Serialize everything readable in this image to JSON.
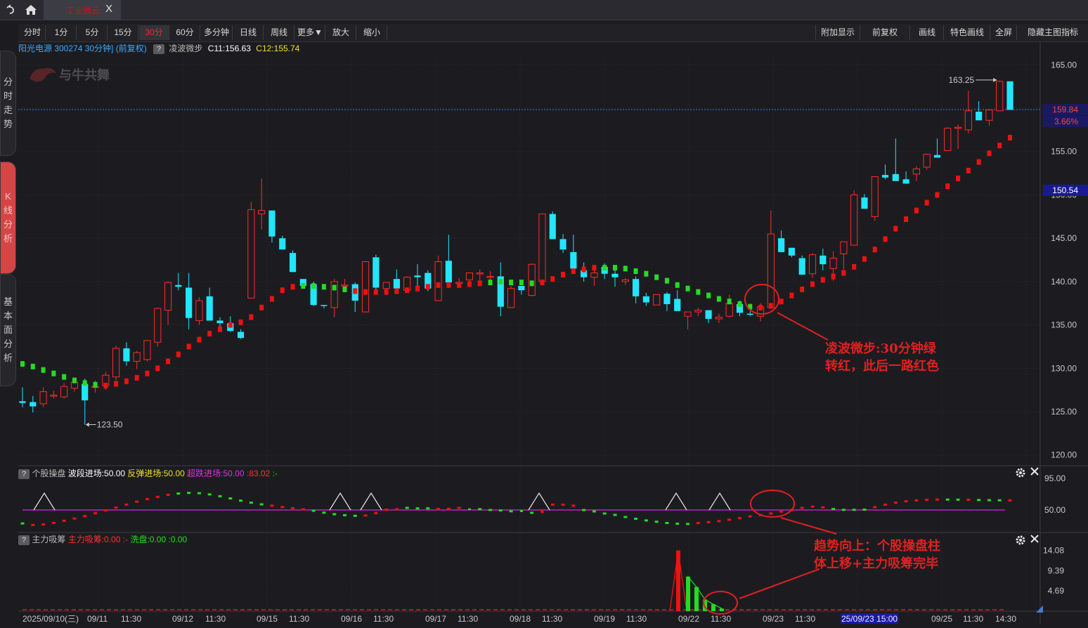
{
  "window": {
    "tab_title": "工业融云",
    "tab_close": "X"
  },
  "side_tabs": [
    {
      "label": "分\n时\n走\n势"
    },
    {
      "label": "K\n线\n分\n析"
    },
    {
      "label": "基\n本\n面\n分\n析"
    }
  ],
  "toolbar": {
    "left": [
      "分时",
      "1分",
      "5分",
      "15分",
      "30分",
      "60分",
      "多分钟",
      "日线",
      "周线",
      "更多▼",
      "放大",
      "缩小"
    ],
    "active": "30分",
    "right": [
      "附加显示",
      "前复权",
      "画线",
      "特色画线",
      "全屏",
      "隐藏主图指标"
    ]
  },
  "info": {
    "stock": "阳光电源 300274 30分钟] (前复权)",
    "help": "?",
    "indicator": "凌波微步",
    "c11": "C11:156.63",
    "c12": "C12:155.74"
  },
  "watermark": "与牛共舞",
  "colors": {
    "up": "#ff2a2a",
    "down": "#23e5ff",
    "green": "#22dd22",
    "red": "#ee1111",
    "magenta": "#dd22dd",
    "axis_text": "#c8c8c8"
  },
  "panel2": {
    "help": "?",
    "name": "个股操盘",
    "l1": "波段进场:50.00",
    "l2": "反弹进场:50.00",
    "l3": "超跌进场:50.00",
    "l4": ":83.02",
    "l5": ":-"
  },
  "panel3": {
    "help": "?",
    "name": "主力吸筹",
    "l1": "主力吸筹:0.00",
    "l2": ":-",
    "l3": "洗盘:0.00",
    "l4": ":0.00"
  },
  "annotations": {
    "a1_line1": "凌波微步:30分钟绿",
    "a1_line2": "转红，此后一路红色",
    "a2_line1": "趋势向上：个股操盘柱",
    "a2_line2": "体上移+主力吸筹完毕"
  },
  "chart_data": [
    {
      "type": "candlestick",
      "title": "阳光电源 300274 30分钟",
      "ylim": [
        119,
        166
      ],
      "yticks": [
        165,
        160,
        155,
        150,
        145,
        140,
        135,
        130,
        125,
        120
      ],
      "ytick_labels": [
        "165.00",
        "",
        "155.00",
        "150.00",
        "145.00",
        "140.00",
        "135.00",
        "130.00",
        "125.00",
        "120.00"
      ],
      "price_tags": [
        {
          "label": "159.84",
          "value": 159.84
        },
        {
          "label": "3.66%",
          "value": 158.4
        },
        {
          "label": "150.54",
          "value": 150.54
        }
      ],
      "markers": [
        {
          "label": "163.25",
          "value": 163.25
        },
        {
          "label": "123.50",
          "value": 123.5
        }
      ],
      "x_labels": [
        "2025/09/10(三)",
        "09/11",
        "11:30",
        "09/12",
        "11:30",
        "09/15",
        "11:30",
        "09/16",
        "11:30",
        "09/17",
        "11:30",
        "09/18",
        "11:30",
        "09/19",
        "11:30",
        "09/22",
        "11:30",
        "09/23",
        "11:30",
        "25/09/23 15:00",
        "09/25",
        "11:30",
        "14:30"
      ],
      "ohlc": [
        [
          126.2,
          127.8,
          125.5,
          126.0
        ],
        [
          126.1,
          126.8,
          124.9,
          125.6
        ],
        [
          125.9,
          127.8,
          125.5,
          127.3
        ],
        [
          126.9,
          127.4,
          126.5,
          126.9
        ],
        [
          126.7,
          128.3,
          126.5,
          127.9
        ],
        [
          127.7,
          128.9,
          127.3,
          128.4
        ],
        [
          128.2,
          128.8,
          123.5,
          126.3
        ],
        [
          127.8,
          128.6,
          127.2,
          127.9
        ],
        [
          128.0,
          129.6,
          127.5,
          129.2
        ],
        [
          129.0,
          132.6,
          128.6,
          132.3
        ],
        [
          132.3,
          133.0,
          130.3,
          130.8
        ],
        [
          130.8,
          132.0,
          129.9,
          131.8
        ],
        [
          131.0,
          133.2,
          130.8,
          133.2
        ],
        [
          133.0,
          137.0,
          132.5,
          136.9
        ],
        [
          136.7,
          140.0,
          135.0,
          139.9
        ],
        [
          139.6,
          141.0,
          139.0,
          139.4
        ],
        [
          139.3,
          141.0,
          134.5,
          135.8
        ],
        [
          135.5,
          138.2,
          135.0,
          137.8
        ],
        [
          138.3,
          139.3,
          136.0,
          135.5
        ],
        [
          135.5,
          135.9,
          134.7,
          135.2
        ],
        [
          135.2,
          136.0,
          134.2,
          134.3
        ],
        [
          134.2,
          134.5,
          133.4,
          133.5
        ],
        [
          138.1,
          149.2,
          138.3,
          148.3
        ],
        [
          147.8,
          151.9,
          146.0,
          148.2
        ],
        [
          148.2,
          148.2,
          144.5,
          145.2
        ],
        [
          145.0,
          145.3,
          143.7,
          143.7
        ],
        [
          143.3,
          143.6,
          141.1,
          141.1
        ],
        [
          140.3,
          140.2,
          139.5,
          139.5
        ],
        [
          139.7,
          140.0,
          137.2,
          137.3
        ],
        [
          137.3,
          137.3,
          136.9,
          137.2
        ],
        [
          137.0,
          140.3,
          135.9,
          140.0
        ],
        [
          139.6,
          140.3,
          139.5,
          139.6
        ],
        [
          139.7,
          139.9,
          136.5,
          137.8
        ],
        [
          136.5,
          142.0,
          136.5,
          142.3
        ],
        [
          142.8,
          143.1,
          139.0,
          139.3
        ],
        [
          139.2,
          139.9,
          139.0,
          139.9
        ],
        [
          140.3,
          141.4,
          139.4,
          139.2
        ],
        [
          139.0,
          140.6,
          139.0,
          140.5
        ],
        [
          140.7,
          142.0,
          139.5,
          140.5
        ],
        [
          141.0,
          141.3,
          138.9,
          139.2
        ],
        [
          137.8,
          143.0,
          138.1,
          142.3
        ],
        [
          142.4,
          145.4,
          139.7,
          139.9
        ],
        [
          139.9,
          140.4,
          139.5,
          139.9
        ],
        [
          140.2,
          141.0,
          140.0,
          141.0
        ],
        [
          140.9,
          141.4,
          140.1,
          141.0
        ],
        [
          140.5,
          141.2,
          139.7,
          140.6
        ],
        [
          140.6,
          142.2,
          136.0,
          137.1
        ],
        [
          137.0,
          139.5,
          137.0,
          139.2
        ],
        [
          139.5,
          139.4,
          138.5,
          139.0
        ],
        [
          138.4,
          142.1,
          138.3,
          142.0
        ],
        [
          140.0,
          147.8,
          141.4,
          147.8
        ],
        [
          147.8,
          148.1,
          144.9,
          144.9
        ],
        [
          144.9,
          145.5,
          143.3,
          143.7
        ],
        [
          143.4,
          145.4,
          142.7,
          141.5
        ],
        [
          141.3,
          142.2,
          140.0,
          140.5
        ],
        [
          140.5,
          141.7,
          139.5,
          141.0
        ],
        [
          141.7,
          142.1,
          140.3,
          140.9
        ],
        [
          140.9,
          141.5,
          139.4,
          140.5
        ],
        [
          140.0,
          140.4,
          139.6,
          140.2
        ],
        [
          140.3,
          140.6,
          137.5,
          138.3
        ],
        [
          138.3,
          138.7,
          137.2,
          137.6
        ],
        [
          137.3,
          138.5,
          137.8,
          138.5
        ],
        [
          138.6,
          138.8,
          136.6,
          137.4
        ],
        [
          138.0,
          139.0,
          136.7,
          136.6
        ],
        [
          136.0,
          136.5,
          134.5,
          136.5
        ],
        [
          136.5,
          137.0,
          136.0,
          136.7
        ],
        [
          136.7,
          136.2,
          135.2,
          135.7
        ],
        [
          135.7,
          136.3,
          135.2,
          135.9
        ],
        [
          136.0,
          138.5,
          136.0,
          137.5
        ],
        [
          137.4,
          137.8,
          136.0,
          136.4
        ],
        [
          136.3,
          136.6,
          136.0,
          136.2
        ],
        [
          136.0,
          137.5,
          135.4,
          137.1
        ],
        [
          137.0,
          148.2,
          137.2,
          145.5
        ],
        [
          145.0,
          145.9,
          143.6,
          143.4
        ],
        [
          143.9,
          143.9,
          142.8,
          143.0
        ],
        [
          142.7,
          143.0,
          140.8,
          140.8
        ],
        [
          140.9,
          143.3,
          140.4,
          143.1
        ],
        [
          143.0,
          143.8,
          141.3,
          142.0
        ],
        [
          141.5,
          143.5,
          140.1,
          142.7
        ],
        [
          143.2,
          144.2,
          141.4,
          144.6
        ],
        [
          144.2,
          150.5,
          144.5,
          150.0
        ],
        [
          149.7,
          150.1,
          148.4,
          148.4
        ],
        [
          147.5,
          152.1,
          147.0,
          152.1
        ],
        [
          152.3,
          153.5,
          151.8,
          152.0
        ],
        [
          152.4,
          156.5,
          151.6,
          151.6
        ],
        [
          151.8,
          152.7,
          151.3,
          151.3
        ],
        [
          152.4,
          153.3,
          151.6,
          153.0
        ],
        [
          153.2,
          154.7,
          152.9,
          154.7
        ],
        [
          154.6,
          156.5,
          154.4,
          154.3
        ],
        [
          155.1,
          157.8,
          155.7,
          157.7
        ],
        [
          157.7,
          158.1,
          155.3,
          157.8
        ],
        [
          157.5,
          162.0,
          157.1,
          159.7
        ],
        [
          159.6,
          160.8,
          158.8,
          158.6
        ],
        [
          158.6,
          159.8,
          158.0,
          159.8
        ],
        [
          159.7,
          163.2,
          159.8,
          163.1
        ],
        [
          163.1,
          162.9,
          159.8,
          159.8
        ]
      ],
      "ling_bo_wei_bu": [
        [
          130.5,
          "g"
        ],
        [
          130.2,
          "g"
        ],
        [
          129.8,
          "g"
        ],
        [
          129.4,
          "g"
        ],
        [
          129.0,
          "g"
        ],
        [
          128.6,
          "g"
        ],
        [
          128.3,
          "g"
        ],
        [
          128.1,
          "g"
        ],
        [
          128.0,
          "r"
        ],
        [
          128.2,
          "r"
        ],
        [
          128.5,
          "r"
        ],
        [
          128.9,
          "r"
        ],
        [
          129.4,
          "r"
        ],
        [
          130.0,
          "r"
        ],
        [
          130.8,
          "r"
        ],
        [
          131.6,
          "r"
        ],
        [
          132.5,
          "r"
        ],
        [
          133.3,
          "r"
        ],
        [
          134.0,
          "r"
        ],
        [
          134.5,
          "r"
        ],
        [
          135.0,
          "r"
        ],
        [
          135.3,
          "r"
        ],
        [
          135.9,
          "r"
        ],
        [
          137.0,
          "r"
        ],
        [
          138.0,
          "r"
        ],
        [
          139.0,
          "r"
        ],
        [
          139.4,
          "r"
        ],
        [
          139.5,
          "g"
        ],
        [
          139.5,
          "g"
        ],
        [
          139.4,
          "g"
        ],
        [
          139.3,
          "g"
        ],
        [
          139.1,
          "g"
        ],
        [
          138.9,
          "r"
        ],
        [
          138.8,
          "r"
        ],
        [
          138.8,
          "r"
        ],
        [
          138.8,
          "r"
        ],
        [
          138.9,
          "r"
        ],
        [
          139.0,
          "r"
        ],
        [
          139.2,
          "r"
        ],
        [
          139.4,
          "r"
        ],
        [
          139.6,
          "r"
        ],
        [
          139.6,
          "r"
        ],
        [
          139.6,
          "r"
        ],
        [
          139.7,
          "r"
        ],
        [
          139.8,
          "r"
        ],
        [
          139.9,
          "g"
        ],
        [
          140.0,
          "g"
        ],
        [
          139.9,
          "g"
        ],
        [
          139.9,
          "g"
        ],
        [
          139.8,
          "g"
        ],
        [
          139.9,
          "r"
        ],
        [
          140.3,
          "r"
        ],
        [
          140.8,
          "r"
        ],
        [
          141.2,
          "r"
        ],
        [
          141.4,
          "r"
        ],
        [
          141.6,
          "r"
        ],
        [
          141.6,
          "g"
        ],
        [
          141.6,
          "g"
        ],
        [
          141.5,
          "g"
        ],
        [
          141.2,
          "g"
        ],
        [
          140.9,
          "g"
        ],
        [
          140.5,
          "g"
        ],
        [
          140.1,
          "g"
        ],
        [
          139.6,
          "g"
        ],
        [
          139.2,
          "g"
        ],
        [
          138.8,
          "g"
        ],
        [
          138.4,
          "g"
        ],
        [
          138.0,
          "g"
        ],
        [
          137.7,
          "g"
        ],
        [
          137.4,
          "g"
        ],
        [
          137.1,
          "g"
        ],
        [
          137.0,
          "r"
        ],
        [
          137.2,
          "r"
        ],
        [
          137.7,
          "r"
        ],
        [
          138.4,
          "r"
        ],
        [
          139.1,
          "r"
        ],
        [
          139.7,
          "r"
        ],
        [
          140.2,
          "r"
        ],
        [
          140.6,
          "r"
        ],
        [
          141.0,
          "r"
        ],
        [
          141.7,
          "r"
        ],
        [
          142.6,
          "r"
        ],
        [
          143.7,
          "r"
        ],
        [
          144.9,
          "r"
        ],
        [
          146.1,
          "r"
        ],
        [
          147.2,
          "r"
        ],
        [
          148.2,
          "r"
        ],
        [
          149.1,
          "r"
        ],
        [
          150.0,
          "r"
        ],
        [
          151.0,
          "r"
        ],
        [
          151.9,
          "r"
        ],
        [
          152.8,
          "r"
        ],
        [
          153.8,
          "r"
        ],
        [
          154.8,
          "r"
        ],
        [
          155.7,
          "r"
        ],
        [
          156.6,
          "r"
        ]
      ]
    },
    {
      "type": "bar",
      "title": "个股操盘",
      "ylim": [
        45,
        100
      ],
      "ytick_labels": [
        "95.00",
        "50.00"
      ],
      "baseline": 50,
      "values": [
        30.8,
        28.6,
        29.4,
        31.6,
        34.6,
        37.8,
        41.3,
        45.3,
        49.4,
        53.5,
        57.7,
        61.8,
        65.5,
        68.7,
        71.5,
        73.4,
        74.3,
        73.9,
        72.2,
        69.6,
        66.5,
        63.3,
        60.4,
        58.0,
        56.2,
        54.2,
        52.6,
        50.9,
        48.9,
        46.2,
        44.0,
        42.6,
        41.7,
        42.2,
        45.5,
        50.5,
        51.0,
        53.0,
        52.3,
        52.3,
        51.4,
        51.7,
        53.0,
        52.3,
        51.2,
        50.0,
        49.3,
        48.2,
        47.0,
        46.0,
        45.5,
        57.6,
        57.5,
        56.2,
        49.9,
        48.0,
        45.0,
        43.0,
        40.0,
        37.5,
        35.1,
        33.3,
        31.5,
        30.4,
        30.1,
        31.4,
        32.7,
        34.1,
        36.1,
        38.5,
        40.9,
        42.8,
        45.1,
        47.6,
        50.0,
        53.0,
        54.8,
        53.8,
        51.4,
        50.2,
        50.2,
        50.5,
        54.0,
        57.5,
        60.3,
        62.4,
        63.6,
        64.4,
        64.8,
        64.8,
        64.7,
        64.5,
        64.2,
        64.0,
        63.8,
        63.6
      ],
      "bar_colors": [
        "g",
        "r",
        "r",
        "r",
        "r",
        "r",
        "r",
        "r",
        "r",
        "r",
        "r",
        "r",
        "r",
        "r",
        "r",
        "g",
        "g",
        "g",
        "g",
        "g",
        "g",
        "g",
        "g",
        "g",
        "r",
        "r",
        "r",
        "r",
        "g",
        "g",
        "g",
        "g",
        "g",
        "r",
        "r",
        "r",
        "r",
        "g",
        "g",
        "g",
        "r",
        "r",
        "r",
        "g",
        "g",
        "g",
        "g",
        "g",
        "g",
        "g",
        "r",
        "r",
        "r",
        "r",
        "g",
        "g",
        "g",
        "g",
        "g",
        "g",
        "g",
        "g",
        "g",
        "g",
        "g",
        "r",
        "r",
        "r",
        "r",
        "r",
        "r",
        "r",
        "r",
        "r",
        "r",
        "r",
        "r",
        "r",
        "g",
        "g",
        "g",
        "g",
        "r",
        "r",
        "r",
        "r",
        "r",
        "r",
        "r",
        "g",
        "g",
        "r",
        "g",
        "g",
        "g",
        "r"
      ]
    },
    {
      "type": "bar",
      "title": "主力吸筹",
      "ylim": [
        0,
        15
      ],
      "ytick_labels": [
        "14.08",
        "9.39",
        "4.69"
      ],
      "values_red": [
        [
          15,
          14.08
        ],
        [
          16,
          0
        ]
      ],
      "values_green": [
        [
          16,
          8.0
        ],
        [
          17,
          5.6
        ],
        [
          18,
          2.7
        ],
        [
          19,
          1.6
        ],
        [
          20,
          0.6
        ]
      ]
    }
  ]
}
